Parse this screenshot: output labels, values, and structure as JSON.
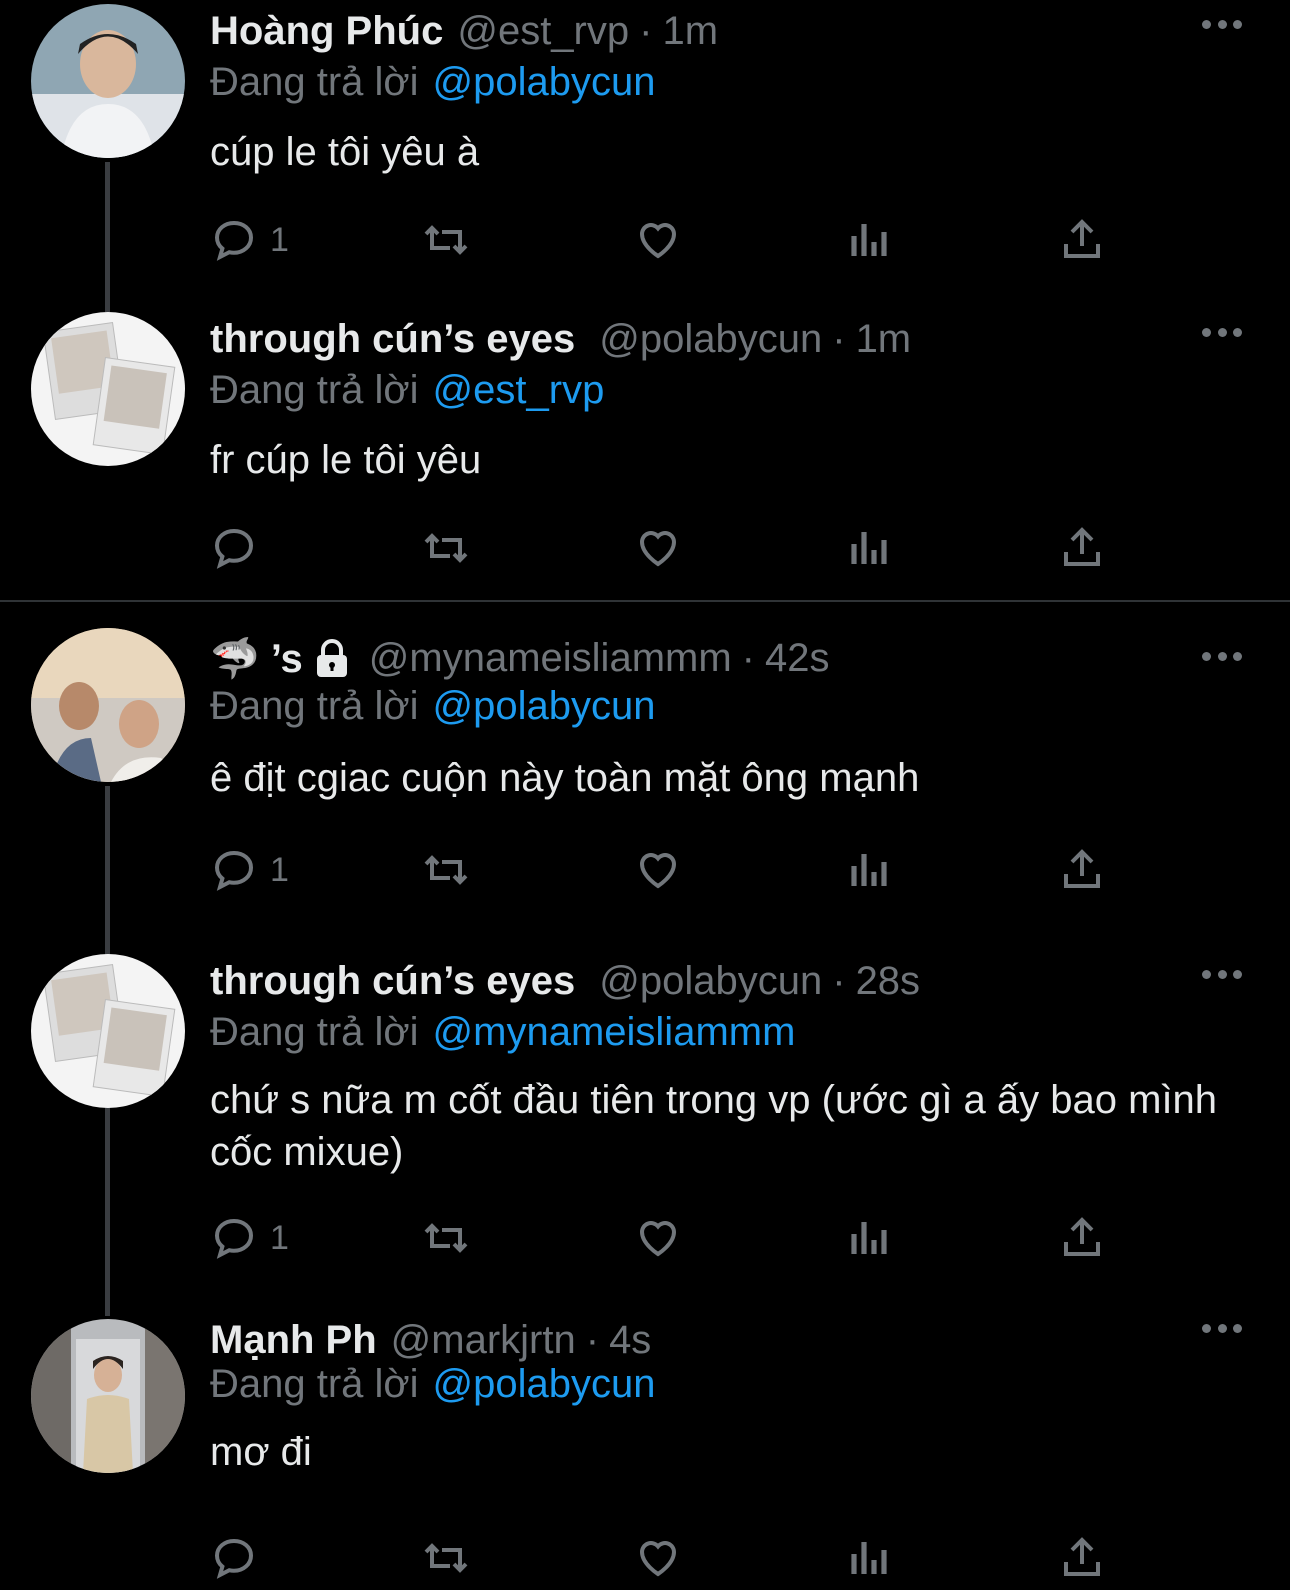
{
  "tweets": [
    {
      "name": "Hoàng Phúc",
      "handle": "@est_rvp",
      "time": "1m",
      "reply_prefix": "Đang trả lời",
      "reply_to": "@polabycun",
      "text": "cúp le tôi yêu à",
      "reply_count": "1"
    },
    {
      "name": "through cún’s eyes",
      "handle": "@polabycun",
      "time": "1m",
      "reply_prefix": "Đang trả lời",
      "reply_to": "@est_rvp",
      "text": "fr cúp le tôi yêu",
      "reply_count": ""
    },
    {
      "name": "🦈 ’s",
      "handle": "@mynameisliammm",
      "time": "42s",
      "reply_prefix": "Đang trả lời",
      "reply_to": "@polabycun",
      "text": "ê địt cgiac cuộn này toàn mặt ông mạnh",
      "reply_count": "1"
    },
    {
      "name": "through cún’s eyes",
      "handle": "@polabycun",
      "time": "28s",
      "reply_prefix": "Đang trả lời",
      "reply_to": "@mynameisliammm",
      "text": "chứ s nữa m cốt đầu tiên trong vp (ước gì a ấy bao mình cốc mixue)",
      "reply_count": "1"
    },
    {
      "name": "Mạnh Ph",
      "handle": "@markjrtn",
      "time": "4s",
      "reply_prefix": "Đang trả lời",
      "reply_to": "@polabycun",
      "text": "mơ đi",
      "reply_count": ""
    }
  ],
  "separator": "·",
  "icons": [
    "reply-icon",
    "retweet-icon",
    "like-icon",
    "views-icon",
    "share-icon",
    "more-icon",
    "lock-icon"
  ],
  "colors": {
    "background": "#000000",
    "text": "#e7e9ea",
    "muted": "#71767b",
    "link": "#1d9bf0"
  }
}
